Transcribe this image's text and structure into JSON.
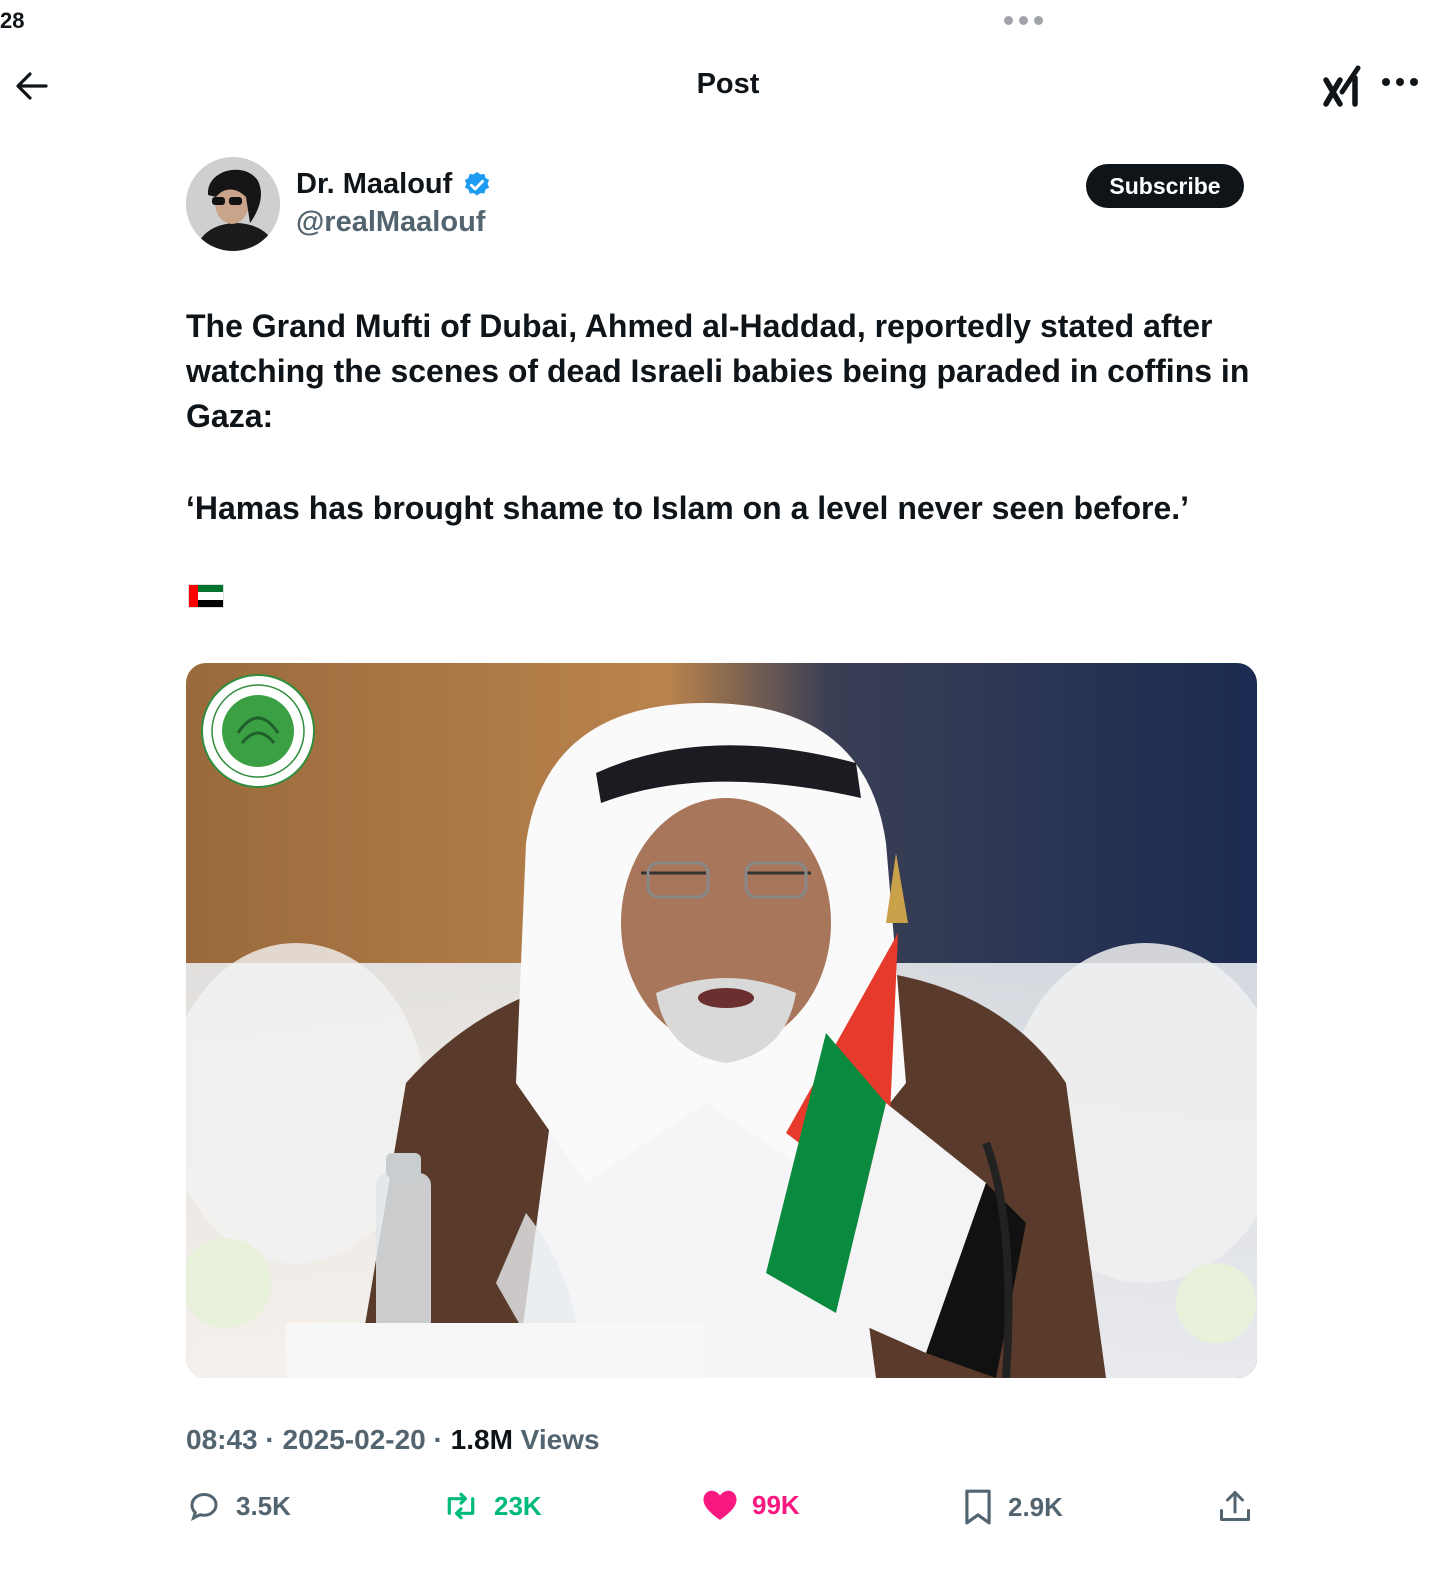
{
  "status_bar": {
    "time": "28"
  },
  "header": {
    "title": "Post"
  },
  "author": {
    "name": "Dr. Maalouf",
    "handle": "@realMaalouf"
  },
  "subscribe_label": "Subscribe",
  "post": {
    "text": "The Grand Mufti of Dubai, Ahmed al-Haddad, reportedly stated after watching the scenes of dead Israeli babies being paraded in coffins in Gaza:",
    "quote": "‘Hamas has brought shame to Islam on a level never seen before.’",
    "emoji": "uae-flag-icon"
  },
  "meta": {
    "time": "08:43",
    "date": "2025-02-20",
    "views_count": "1.8M",
    "views_label": "Views",
    "separator": "·"
  },
  "actions": {
    "replies": "3.5K",
    "reposts": "23K",
    "likes": "99K",
    "bookmarks": "2.9K"
  },
  "colors": {
    "repost": "#00ba7c",
    "like": "#f91880",
    "verified": "#1d9bf0",
    "muted": "#536471"
  }
}
